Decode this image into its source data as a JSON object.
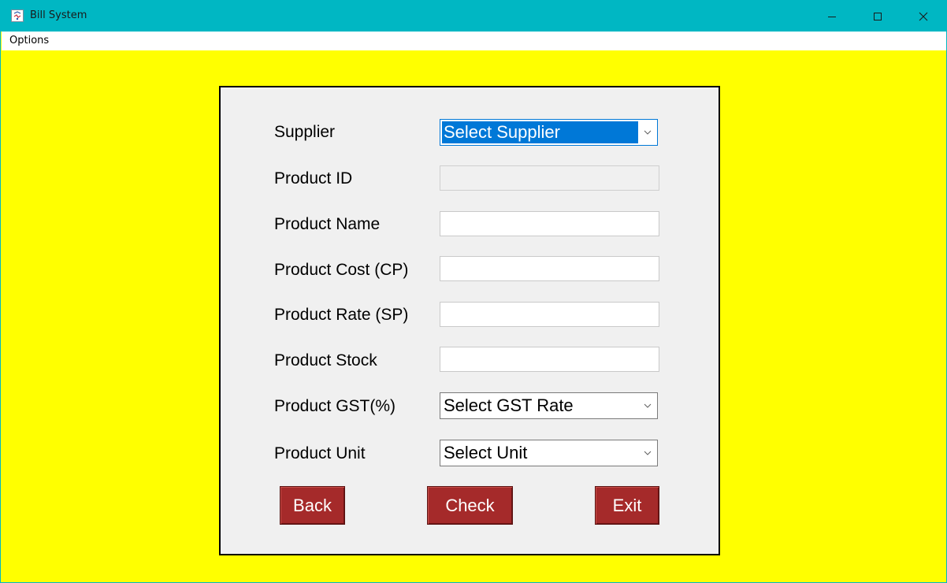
{
  "window": {
    "title": "Bill System",
    "controls": {
      "minimize_icon": "minimize-icon",
      "maximize_icon": "maximize-icon",
      "close_icon": "close-icon"
    }
  },
  "menu": {
    "items": [
      {
        "label": "Options"
      }
    ]
  },
  "colors": {
    "titlebar": "#00b7c3",
    "background": "#ffff00",
    "panel": "#f0f0f0",
    "button": "#a52a2a",
    "selection": "#0078d7"
  },
  "form": {
    "supplier": {
      "label": "Supplier",
      "selected": "Select Supplier"
    },
    "product_id": {
      "label": "Product ID",
      "value": ""
    },
    "product_name": {
      "label": "Product Name",
      "value": ""
    },
    "product_cost": {
      "label": "Product Cost (CP)",
      "value": ""
    },
    "product_rate": {
      "label": "Product Rate (SP)",
      "value": ""
    },
    "product_stock": {
      "label": "Product Stock",
      "value": ""
    },
    "product_gst": {
      "label": "Product GST(%)",
      "selected": "Select GST Rate"
    },
    "product_unit": {
      "label": "Product Unit",
      "selected": "Select Unit"
    }
  },
  "buttons": {
    "back": "Back",
    "check": "Check",
    "exit": "Exit"
  }
}
